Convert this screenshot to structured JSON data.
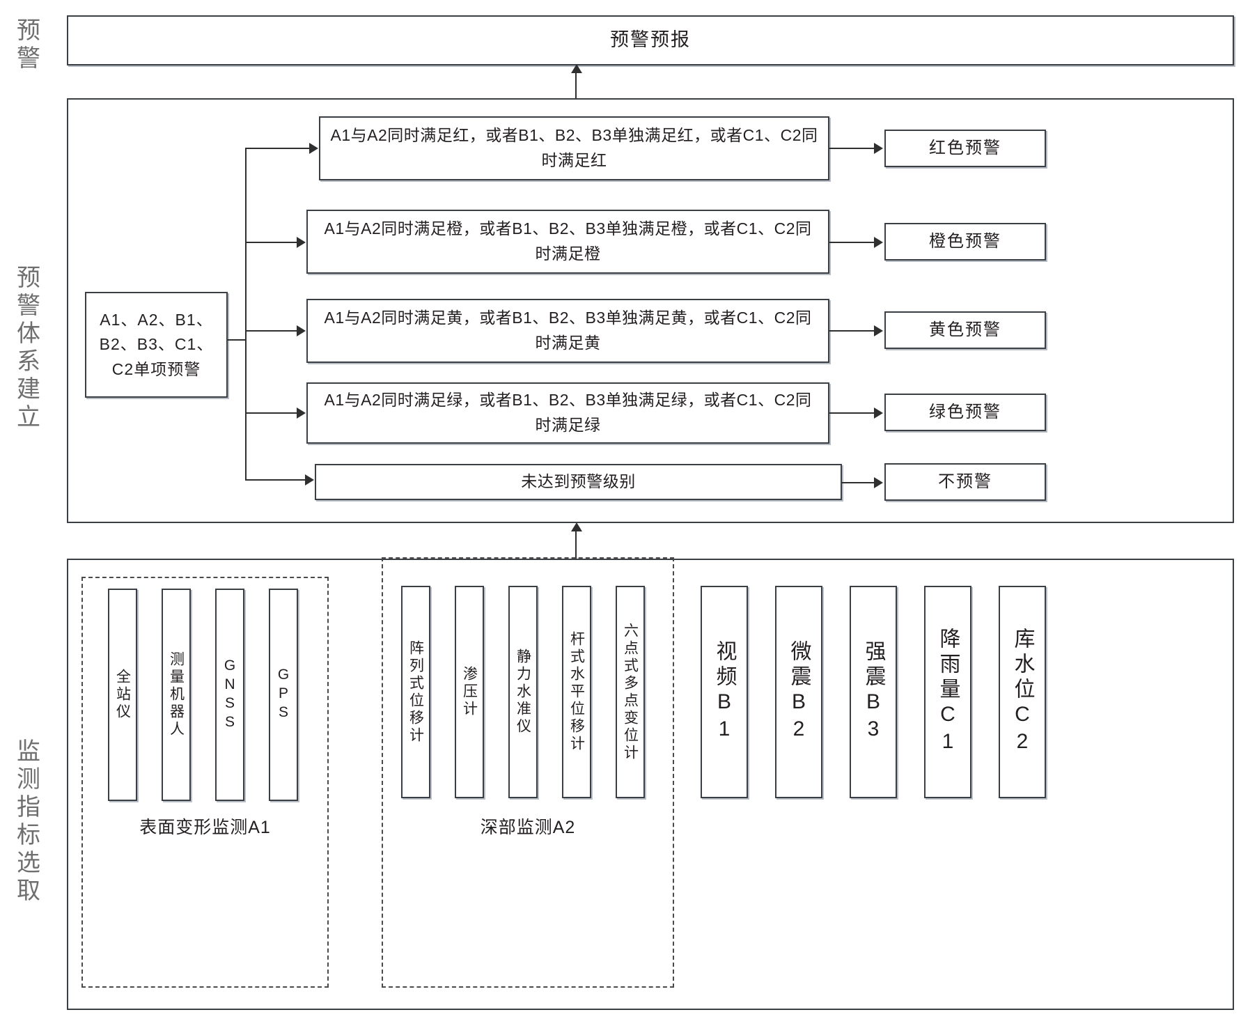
{
  "rails": [
    {
      "id": "rail-warning",
      "label": "预警"
    },
    {
      "id": "rail-system",
      "label": "预警体系建立"
    },
    {
      "id": "rail-indicator",
      "label": "监测指标选取"
    }
  ],
  "header": {
    "title": "预警预报"
  },
  "system": {
    "source_label": "A1、A2、B1、B2、B3、C1、C2单项预警",
    "rules": [
      {
        "id": "rule-red",
        "condition": "A1与A2同时满足红，或者B1、B2、B3单独满足红，或者C1、C2同时满足红",
        "output": "红色预警"
      },
      {
        "id": "rule-orange",
        "condition": "A1与A2同时满足橙，或者B1、B2、B3单独满足橙，或者C1、C2同时满足橙",
        "output": "橙色预警"
      },
      {
        "id": "rule-yellow",
        "condition": "A1与A2同时满足黄，或者B1、B2、B3单独满足黄，或者C1、C2同时满足黄",
        "output": "黄色预警"
      },
      {
        "id": "rule-green",
        "condition": "A1与A2同时满足绿，或者B1、B2、B3单独满足绿，或者C1、C2同时满足绿",
        "output": "绿色预警"
      },
      {
        "id": "rule-none",
        "condition": "未达到预警级别",
        "output": "不预警"
      }
    ]
  },
  "monitoring": {
    "group_a1": {
      "label": "表面变形监测A1",
      "items": [
        {
          "id": "sensor-total-station",
          "label": "全站仪"
        },
        {
          "id": "sensor-measuring-robot",
          "label": "测量机器人"
        },
        {
          "id": "sensor-gnss",
          "label": "GNSS"
        },
        {
          "id": "sensor-gps",
          "label": "GPS"
        }
      ]
    },
    "group_a2": {
      "label": "深部监测A2",
      "items": [
        {
          "id": "sensor-array-displacement",
          "label": "阵列式位移计"
        },
        {
          "id": "sensor-osmometer",
          "label": "渗压计"
        },
        {
          "id": "sensor-hydrostatic-level",
          "label": "静力水准仪"
        },
        {
          "id": "sensor-rod-horizontal-displacement",
          "label": "杆式水平位移计"
        },
        {
          "id": "sensor-six-point-multipoint",
          "label": "六点式多点变位计"
        }
      ]
    },
    "standalone": [
      {
        "id": "sensor-video-b1",
        "label": "视频B1"
      },
      {
        "id": "sensor-microseismic-b2",
        "label": "微震B2"
      },
      {
        "id": "sensor-strong-motion-b3",
        "label": "强震B3"
      },
      {
        "id": "sensor-rainfall-c1",
        "label": "降雨量C1"
      },
      {
        "id": "sensor-reservoir-level-c2",
        "label": "库水位C2"
      }
    ]
  }
}
